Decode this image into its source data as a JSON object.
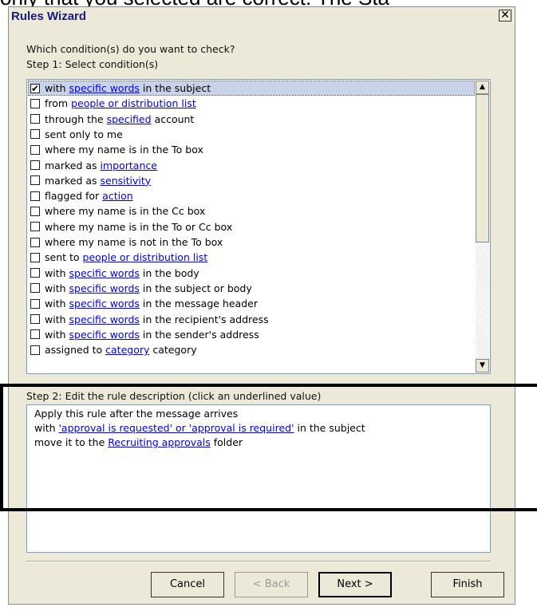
{
  "background_text": "only that you selected are correct.  The Sta",
  "window": {
    "title": "Rules Wizard",
    "close_glyph": "✕"
  },
  "step1": {
    "question": "Which condition(s) do you want to check?",
    "label": "Step 1: Select condition(s)",
    "conditions": [
      {
        "checked": true,
        "parts": [
          "with ",
          "specific words",
          " in the subject"
        ]
      },
      {
        "checked": false,
        "parts": [
          "from ",
          "people or distribution list",
          ""
        ]
      },
      {
        "checked": false,
        "parts": [
          "through the ",
          "specified",
          " account"
        ]
      },
      {
        "checked": false,
        "parts": [
          "sent only to me",
          "",
          ""
        ]
      },
      {
        "checked": false,
        "parts": [
          "where my name is in the To box",
          "",
          ""
        ]
      },
      {
        "checked": false,
        "parts": [
          "marked as ",
          "importance",
          ""
        ]
      },
      {
        "checked": false,
        "parts": [
          "marked as ",
          "sensitivity",
          ""
        ]
      },
      {
        "checked": false,
        "parts": [
          "flagged for ",
          "action",
          ""
        ]
      },
      {
        "checked": false,
        "parts": [
          "where my name is in the Cc box",
          "",
          ""
        ]
      },
      {
        "checked": false,
        "parts": [
          "where my name is in the To or Cc box",
          "",
          ""
        ]
      },
      {
        "checked": false,
        "parts": [
          "where my name is not in the To box",
          "",
          ""
        ]
      },
      {
        "checked": false,
        "parts": [
          "sent to ",
          "people or distribution list",
          ""
        ]
      },
      {
        "checked": false,
        "parts": [
          "with ",
          "specific words",
          " in the body"
        ]
      },
      {
        "checked": false,
        "parts": [
          "with ",
          "specific words",
          " in the subject or body"
        ]
      },
      {
        "checked": false,
        "parts": [
          "with ",
          "specific words",
          " in the message header"
        ]
      },
      {
        "checked": false,
        "parts": [
          "with ",
          "specific words",
          " in the recipient's address"
        ]
      },
      {
        "checked": false,
        "parts": [
          "with ",
          "specific words",
          " in the sender's address"
        ]
      },
      {
        "checked": false,
        "parts": [
          "assigned to ",
          "category",
          " category"
        ]
      }
    ]
  },
  "step2": {
    "label": "Step 2: Edit the rule description (click an underlined value)",
    "lines": [
      {
        "pre": "Apply this rule after the message arrives",
        "link": "",
        "post": ""
      },
      {
        "pre": "with ",
        "link": "'approval is requested' or 'approval is required'",
        "post": " in the subject"
      },
      {
        "pre": "move it to the ",
        "link": "Recruiting approvals",
        "post": " folder"
      }
    ]
  },
  "buttons": {
    "cancel": "Cancel",
    "back": "< Back",
    "next": "Next >",
    "finish": "Finish"
  },
  "colors": {
    "link": "#0000ee",
    "dialog_bg": "#ece9d8",
    "title": "#1a1a7a"
  }
}
